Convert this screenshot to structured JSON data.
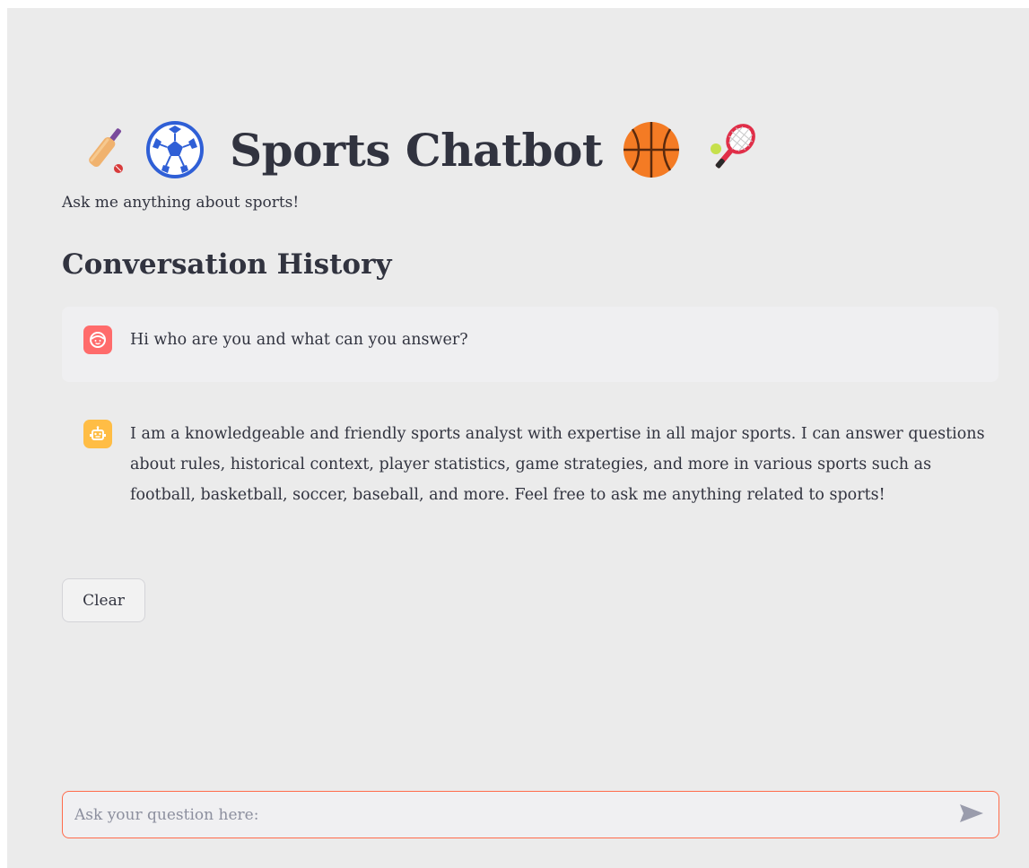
{
  "header": {
    "title": "Sports Chatbot",
    "icons": [
      "cricket-bat-icon",
      "soccer-ball-icon",
      "basketball-icon",
      "tennis-racket-icon"
    ],
    "subtitle": "Ask me anything about sports!"
  },
  "history": {
    "heading": "Conversation History",
    "messages": [
      {
        "role": "user",
        "avatar_icon": "user-face-icon",
        "avatar_color": "#ff6b6b",
        "text": "Hi who are you and what can you answer?"
      },
      {
        "role": "assistant",
        "avatar_icon": "robot-icon",
        "avatar_color": "#ffbd45",
        "text": "I am a knowledgeable and friendly sports analyst with expertise in all major sports. I can answer questions about rules, historical context, player statistics, game strategies, and more in various sports such as football, basketball, soccer, baseball, and more. Feel free to ask me anything related to sports!"
      }
    ]
  },
  "controls": {
    "clear_label": "Clear"
  },
  "chat_input": {
    "placeholder": "Ask your question here:",
    "value": "",
    "send_icon": "send-icon",
    "border_color": "#ff6b4b"
  },
  "colors": {
    "background": "#ebebeb",
    "text": "#31333f",
    "user_bubble": "#efeff1"
  }
}
